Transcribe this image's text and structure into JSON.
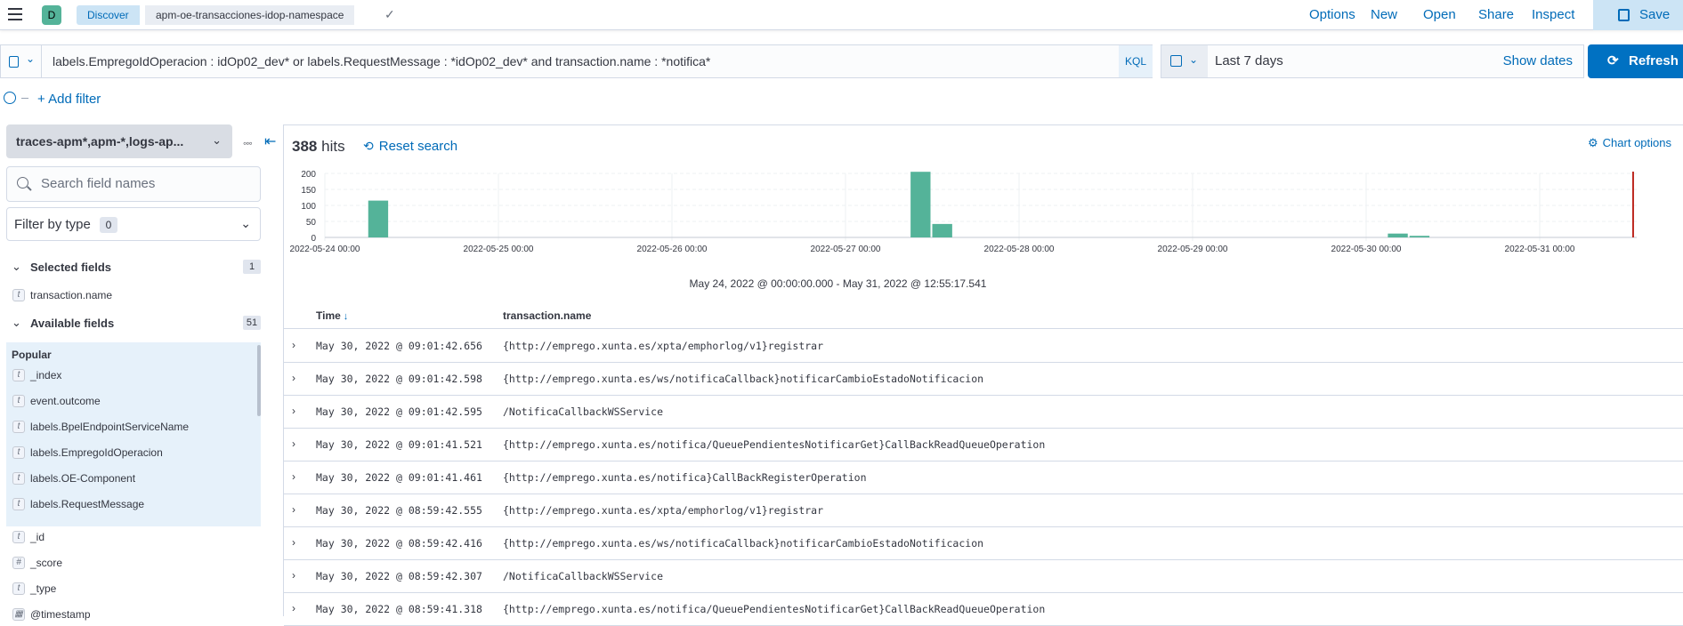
{
  "header": {
    "menu_icon": "hamburger-menu-icon",
    "space_initial": "D",
    "breadcrumbs": [
      "Discover",
      "apm-oe-transacciones-idop-namespace"
    ],
    "menu": [
      "Options",
      "New",
      "Open",
      "Share",
      "Inspect"
    ],
    "save_label": "Save"
  },
  "query": {
    "text": "labels.EmpregoIdOperacion : idOp02_dev* or labels.RequestMessage : *idOp02_dev* and transaction.name : *notifica*",
    "language": "KQL",
    "date_label": "Last 7 days",
    "show_dates": "Show dates",
    "refresh_label": "Refresh",
    "add_filter": "+ Add filter"
  },
  "sidebar": {
    "index_pattern": "traces-apm*,apm-*,logs-ap...",
    "search_placeholder": "Search field names",
    "filter_by_type": "Filter by type",
    "filter_count": "0",
    "selected_title": "Selected fields",
    "selected_count": "1",
    "selected_fields": [
      {
        "type": "t",
        "name": "transaction.name"
      }
    ],
    "available_title": "Available fields",
    "available_count": "51",
    "popular_title": "Popular",
    "popular_fields": [
      {
        "type": "t",
        "name": "_index"
      },
      {
        "type": "t",
        "name": "event.outcome"
      },
      {
        "type": "t",
        "name": "labels.BpelEndpointServiceName"
      },
      {
        "type": "t",
        "name": "labels.EmpregoIdOperacion"
      },
      {
        "type": "t",
        "name": "labels.OE-Component"
      },
      {
        "type": "t",
        "name": "labels.RequestMessage"
      }
    ],
    "other_fields": [
      {
        "type": "t",
        "name": "_id"
      },
      {
        "type": "#",
        "name": "_score"
      },
      {
        "type": "t",
        "name": "_type"
      },
      {
        "type": "cal",
        "name": "@timestamp"
      }
    ]
  },
  "main": {
    "hits_count": "388",
    "hits_label": "hits",
    "reset_search": "Reset search",
    "chart_options": "Chart options",
    "range_label": "May 24, 2022 @ 00:00:00.000 - May 31, 2022 @ 12:55:17.541",
    "columns": [
      "Time",
      "transaction.name"
    ],
    "rows": [
      {
        "time": "May 30, 2022 @ 09:01:42.656",
        "name": "{http://emprego.xunta.es/xpta/emphorlog/v1}registrar"
      },
      {
        "time": "May 30, 2022 @ 09:01:42.598",
        "name": "{http://emprego.xunta.es/ws/notificaCallback}notificarCambioEstadoNotificacion"
      },
      {
        "time": "May 30, 2022 @ 09:01:42.595",
        "name": "/NotificaCallbackWSService"
      },
      {
        "time": "May 30, 2022 @ 09:01:41.521",
        "name": "{http://emprego.xunta.es/notifica/QueuePendientesNotificarGet}CallBackReadQueueOperation"
      },
      {
        "time": "May 30, 2022 @ 09:01:41.461",
        "name": "{http://emprego.xunta.es/notifica}CallBackRegisterOperation"
      },
      {
        "time": "May 30, 2022 @ 08:59:42.555",
        "name": "{http://emprego.xunta.es/xpta/emphorlog/v1}registrar"
      },
      {
        "time": "May 30, 2022 @ 08:59:42.416",
        "name": "{http://emprego.xunta.es/ws/notificaCallback}notificarCambioEstadoNotificacion"
      },
      {
        "time": "May 30, 2022 @ 08:59:42.307",
        "name": "/NotificaCallbackWSService"
      },
      {
        "time": "May 30, 2022 @ 08:59:41.318",
        "name": "{http://emprego.xunta.es/notifica/QueuePendientesNotificarGet}CallBackReadQueueOperation"
      }
    ]
  },
  "chart_data": {
    "type": "bar",
    "x_ticks": [
      "2022-05-24 00:00",
      "2022-05-25 00:00",
      "2022-05-26 00:00",
      "2022-05-27 00:00",
      "2022-05-28 00:00",
      "2022-05-29 00:00",
      "2022-05-30 00:00",
      "2022-05-31 00:00"
    ],
    "x": [
      "2022-05-24 06:00",
      "2022-05-27 09:00",
      "2022-05-27 12:00",
      "2022-05-30 03:00",
      "2022-05-30 06:00"
    ],
    "values": [
      115,
      205,
      42,
      12,
      5
    ],
    "y_ticks": [
      0,
      50,
      100,
      150,
      200
    ],
    "ylim": [
      0,
      200
    ],
    "grid": true,
    "bar_color": "#54b399",
    "now_marker_color": "#bd271e"
  }
}
